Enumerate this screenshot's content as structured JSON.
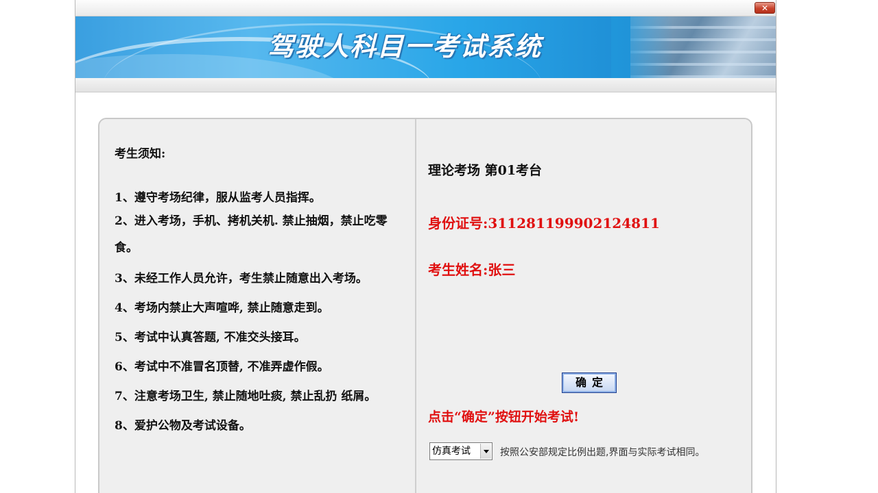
{
  "window": {
    "close_symbol": "✕"
  },
  "banner": {
    "title": "驾驶人科目一考试系统"
  },
  "notice": {
    "title": "考生须知:",
    "rules": [
      "1、遵守考场纪律，服从监考人员指挥。",
      "2、进入考场，手机、拷机关机. 禁止抽烟，禁止吃零食。",
      "3、未经工作人员允许，考生禁止随意出入考场。",
      "4、考场内禁止大声喧哗, 禁止随意走到。",
      "5、考试中认真答题, 不准交头接耳。",
      "6、考试中不准冒名顶替, 不准弄虚作假。",
      "7、注意考场卫生, 禁止随地吐痰, 禁止乱扔 纸屑。",
      "8、爱护公物及考试设备。"
    ]
  },
  "exam": {
    "venue": "理论考场  第01考台",
    "id_label": "身份证号:",
    "id_number": "311281199902124811",
    "name_label": "考生姓名:",
    "name": "张三",
    "confirm_label": "确定",
    "hint": "点击“确定”按钮开始考试!",
    "mode_selected": "仿真考试",
    "mode_description": "按照公安部规定比例出题,界面与实际考试相同。"
  },
  "icons": {
    "close": "close-icon",
    "dropdown": "chevron-down-icon"
  },
  "colors": {
    "banner_blue": "#29a6e8",
    "alert_red": "#e01010",
    "panel_bg": "#efefef"
  }
}
